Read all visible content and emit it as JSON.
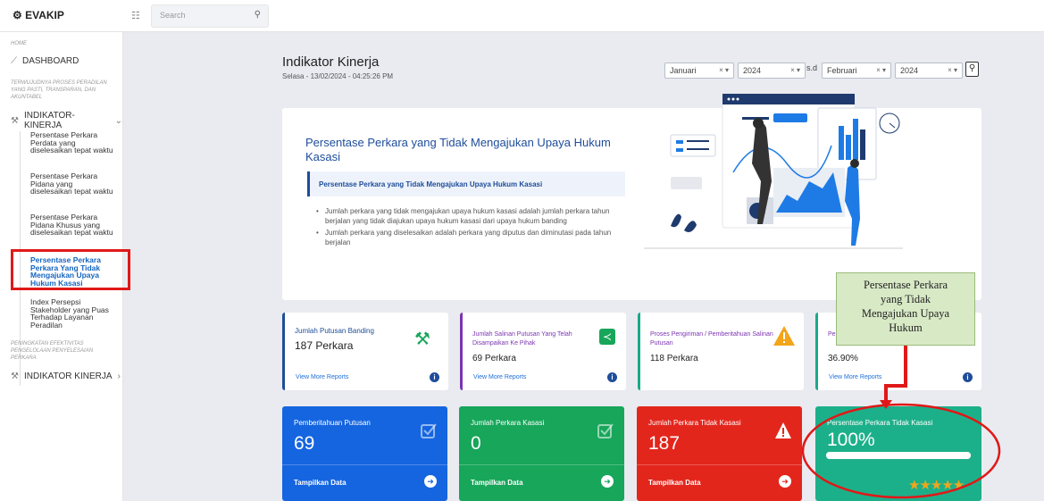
{
  "topbar": {
    "logo": "EVAKIP",
    "search_placeholder": "Search"
  },
  "sidebar": {
    "home_label": "HOME",
    "dashboard_label": "DASHBOARD",
    "section1": "TERWUJUDNYA PROSES PERADILAN YANG PASTI, TRANSPARAN, DAN AKUNTABEL",
    "group1_label": "INDIKATOR-KINERJA",
    "sub_items": [
      "Persentase Perkara Perdata yang diselesaikan tepat waktu",
      "Persentase Perkara Pidana yang diselesaikan tepat waktu",
      "Persentase Perkara Pidana Khusus yang diselesaikan tepat waktu",
      "Persentase Perkara Perkara Yang Tidak Mengajukan Upaya Hukum Kasasi",
      "Index Persepsi Stakeholder yang Puas Terhadap Layanan Peradilan"
    ],
    "section2": "PENINGKATAN EFEKTIVITAS PENGELOLAAN PENYELESAIAN PERKARA",
    "group2_label": "INDIKATOR KINERJA"
  },
  "header": {
    "title": "Indikator Kinerja",
    "datetime": "Selasa - 13/02/2024 - 04:25:26 PM"
  },
  "filters": {
    "month_from": "Januari",
    "year_from": "2024",
    "separator": "s.d",
    "month_to": "Februari",
    "year_to": "2024"
  },
  "hero": {
    "title": "Persentase Perkara yang Tidak Mengajukan Upaya Hukum Kasasi",
    "subtitle": "Persentase Perkara yang Tidak Mengajukan Upaya Hukum Kasasi",
    "bullets": [
      "Jumlah perkara yang tidak mengajukan upaya hukum kasasi adalah jumlah perkara tahun berjalan yang tidak diajukan upaya hukum kasasi dari upaya hukum banding",
      "Jumlah perkara yang diselesaikan adalah perkara yang diputus dan diminutasi pada tahun berjalan"
    ]
  },
  "cards": [
    {
      "title": "Jumlah Putusan Banding",
      "value": "187 Perkara",
      "link": "View More Reports",
      "border": "#1e4d9a"
    },
    {
      "title": "Jumlah Salinan Putusan Yang Telah Disampaikan Ke Pihak",
      "value": "69 Perkara",
      "link": "View More Reports",
      "border": "#7b35b0"
    },
    {
      "title": "Proses Pengiriman / Pemberitahuan Salinan Putusan",
      "value": "118 Perkara",
      "link": "",
      "border": "#1aa98a"
    },
    {
      "title": "Pe... Te...",
      "value": "36.90%",
      "link": "View More Reports",
      "border": "#1aa98a"
    }
  ],
  "big_cards": [
    {
      "title": "Pemberitahuan Putusan",
      "value": "69",
      "action": "Tampilkan Data",
      "color": "#1565e0"
    },
    {
      "title": "Jumlah Perkara Kasasi",
      "value": "0",
      "action": "Tampilkan Data",
      "color": "#17a65a"
    },
    {
      "title": "Jumlah Perkara Tidak Kasasi",
      "value": "187",
      "action": "Tampilkan Data",
      "color": "#e3261c"
    },
    {
      "title": "Persentase Perkara Tidak Kasasi",
      "value": "100%",
      "progress": 1.0,
      "rating": 5,
      "color": "#1cb08a"
    }
  ],
  "callout": {
    "lines": [
      "Persentase Perkara",
      "yang Tidak",
      "Mengajukan Upaya",
      "Hukum"
    ]
  }
}
